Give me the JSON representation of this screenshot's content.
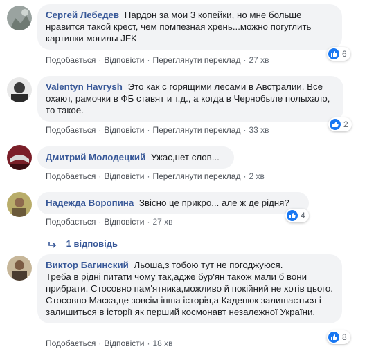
{
  "comments": [
    {
      "author": "Сергей Лебедев",
      "text": "Пардон за мои 3 копейки, но мне больше нравится такой крест, чем помпезная хрень...можно погуглить картинки могилы JFK",
      "actions": {
        "like": "Подобається",
        "reply": "Відповісти",
        "translate": "Переглянути переклад",
        "time": "27 хв"
      },
      "reaction_count": "6"
    },
    {
      "author": "Valentyn Havrysh",
      "text": "Это как с горящими лесами в Австралии. Все охают, рамочки в ФБ ставят и т.д., а когда в Чернобыле полыхало, то такое.",
      "actions": {
        "like": "Подобається",
        "reply": "Відповісти",
        "translate": "Переглянути переклад",
        "time": "33 хв"
      },
      "reaction_count": "2"
    },
    {
      "author": "Дмитрий Молодецкий",
      "text": "Ужас,нет слов...",
      "actions": {
        "like": "Подобається",
        "reply": "Відповісти",
        "translate": "Переглянути переклад",
        "time": "2 хв"
      }
    },
    {
      "author": "Надежда Воропина",
      "text": "Звісно це прикро... але ж де рідня?",
      "actions": {
        "like": "Подобається",
        "reply": "Відповісти",
        "time": "27 хв"
      },
      "reaction_count": "4",
      "replies_label": "1 відповідь"
    },
    {
      "author": "Виктор Багинский",
      "text_lines": [
        "Льоша,з тобою тут не погоджуюся.",
        "Треба в рідні питати чому так,адже бур'ян також мали б вони прибрати. Стосовно пам'ятника,можливо й покійний не хотів цього.",
        "Стосовно Маска,це зовсім інша історія,а Каденюк залишається і залишиться в історії як перший космонавт незалежної України."
      ],
      "actions": {
        "like": "Подобається",
        "reply": "Відповісти",
        "time": "18 хв"
      },
      "reaction_count": "8"
    }
  ],
  "colors": {
    "author": "#385898",
    "bubble": "#f2f3f5",
    "like_blue": "#1877f2",
    "meta": "#606770"
  },
  "icons": [
    "like-icon",
    "reply-arrow-icon"
  ]
}
